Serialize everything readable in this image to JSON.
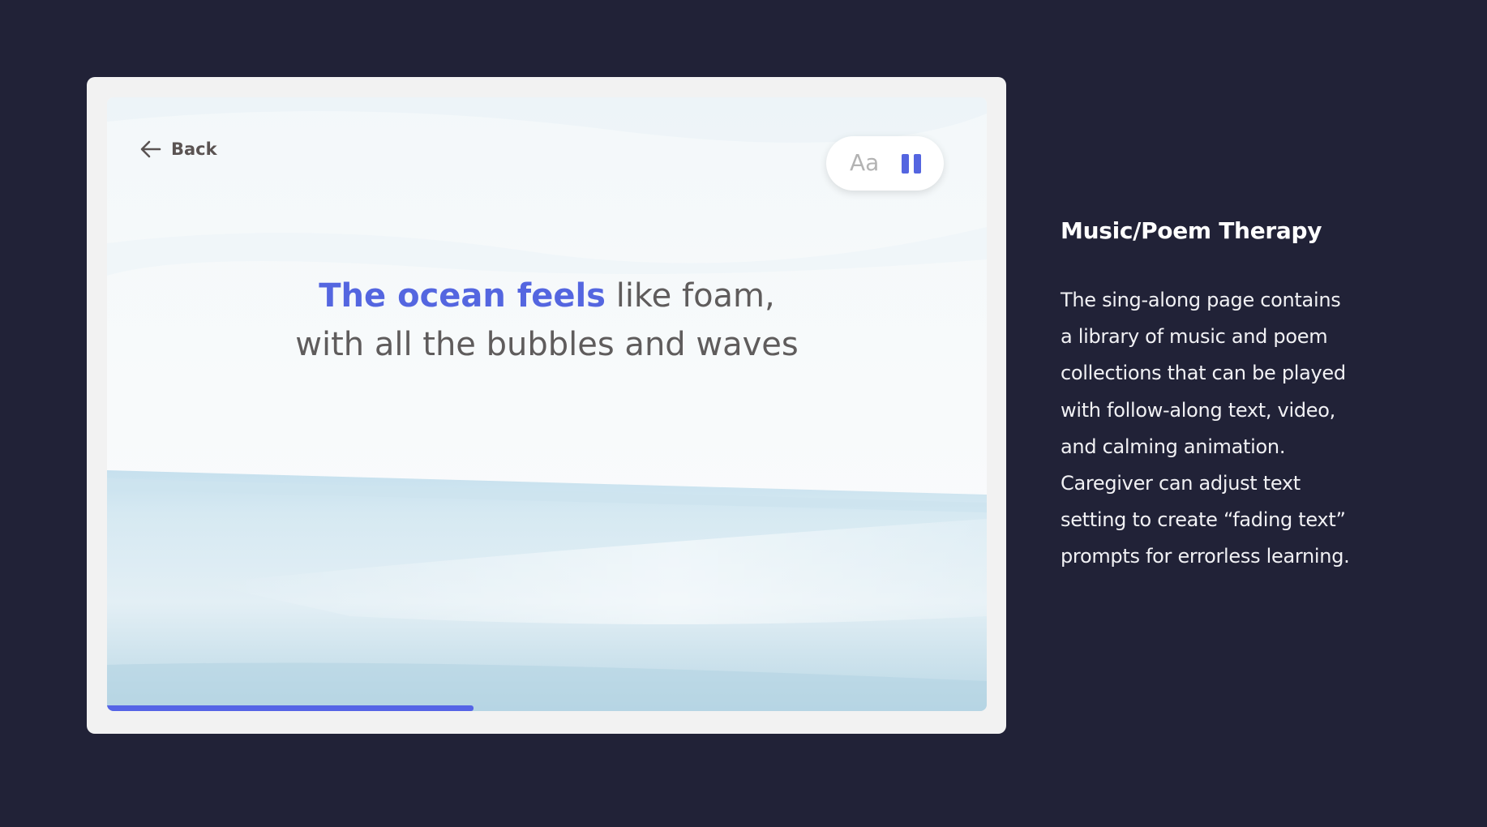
{
  "player": {
    "back_label": "Back",
    "font_size_label": "Aa",
    "lyrics": {
      "line1_highlight": "The ocean feels",
      "line1_rest": " like foam,",
      "line2": "with all the bubbles and waves"
    },
    "progress": 0.417,
    "accent_color": "#5465e0"
  },
  "description": {
    "title": "Music/Poem Therapy",
    "lines": [
      "The sing-along page contains",
      "a library of music and poem",
      "collections that can be played",
      "with follow-along text, video,",
      "and calming animation.",
      "Caregiver can adjust text",
      "setting to create “fading text”",
      "prompts for errorless learning."
    ]
  },
  "icons": {
    "back": "arrow-left-icon",
    "pause": "pause-icon"
  }
}
